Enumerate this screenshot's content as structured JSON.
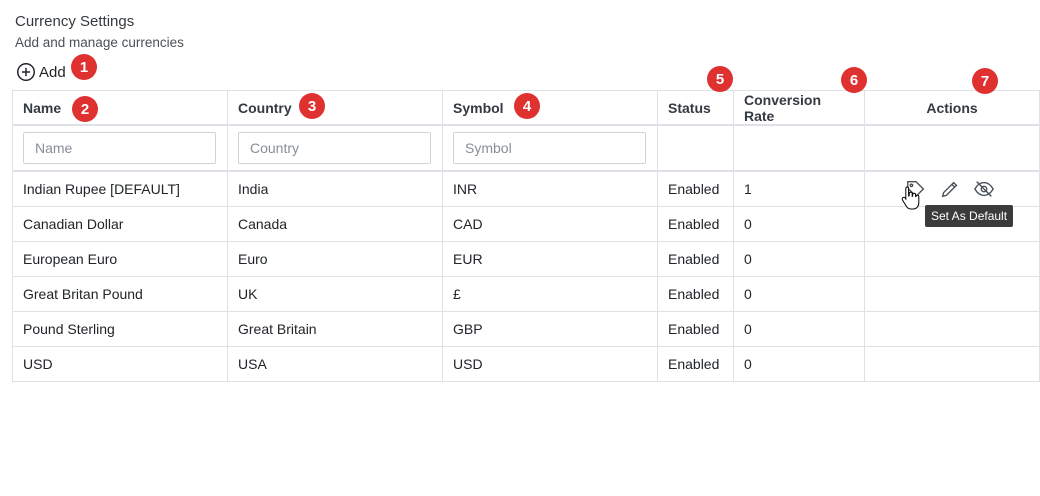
{
  "header": {
    "title": "Currency Settings",
    "subtitle": "Add and manage currencies",
    "add_label": "Add"
  },
  "badges": [
    "1",
    "2",
    "3",
    "4",
    "5",
    "6",
    "7"
  ],
  "table": {
    "columns": [
      "Name",
      "Country",
      "Symbol",
      "Status",
      "Conversion Rate",
      "Actions"
    ],
    "filters": {
      "name_placeholder": "Name",
      "country_placeholder": "Country",
      "symbol_placeholder": "Symbol"
    },
    "rows": [
      {
        "name": "Indian Rupee [DEFAULT]",
        "country": "India",
        "symbol": "INR",
        "status": "Enabled",
        "rate": "1"
      },
      {
        "name": "Canadian Dollar",
        "country": "Canada",
        "symbol": "CAD",
        "status": "Enabled",
        "rate": "0"
      },
      {
        "name": "European Euro",
        "country": "Euro",
        "symbol": "EUR",
        "status": "Enabled",
        "rate": "0"
      },
      {
        "name": "Great Britan Pound",
        "country": "UK",
        "symbol": "£",
        "status": "Enabled",
        "rate": "0"
      },
      {
        "name": "Pound Sterling",
        "country": "Great Britain",
        "symbol": "GBP",
        "status": "Enabled",
        "rate": "0"
      },
      {
        "name": "USD",
        "country": "USA",
        "symbol": "USD",
        "status": "Enabled",
        "rate": "0"
      }
    ]
  },
  "actions": {
    "icons": [
      "tag-icon",
      "pencil-icon",
      "eye-off-icon"
    ],
    "tooltip": "Set As Default"
  },
  "colors": {
    "badge": "#e03131",
    "border": "#dee2e6",
    "tooltip_bg": "#3b3b3b"
  }
}
